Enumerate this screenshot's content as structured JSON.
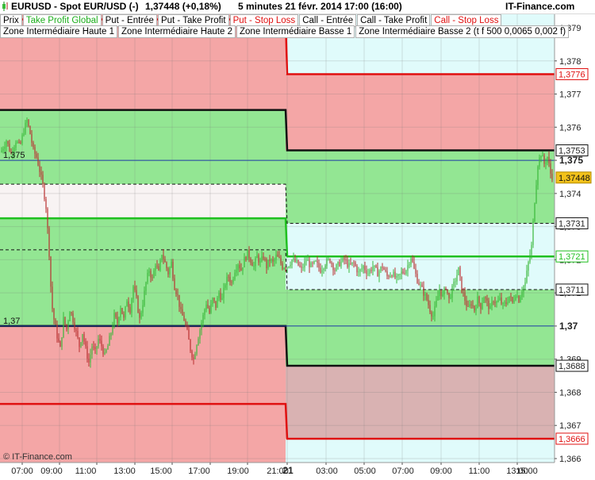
{
  "header": {
    "instrument": "EURUSD - Spot EUR/USD (-)",
    "quote": "1,37448 (+0,18%)",
    "period": "5 minutes  21 févr. 2014 17:00 (16:00)",
    "brand": "IT-Finance.com"
  },
  "legend_row1": [
    "Prix",
    "Take Profit Global",
    "Put - Entrée",
    "Put - Take Profit",
    "Put - Stop Loss",
    "Call - Entrée",
    "Call - Take Profit",
    "Call - Stop Loss"
  ],
  "legend_row2": [
    "Zone Intermédiaire Haute 1",
    "Zone Intermédiaire Haute 2",
    "Zone Intermédiaire Basse 1",
    "Zone Intermédiaire Basse 2 (t f 500 0,0065 0,002 f)"
  ],
  "watermark": "© IT-Finance.com",
  "colors": {
    "red_zone": "#f4a6a6",
    "green_zone": "#93e693",
    "cyan_zone": "#e0fbfb",
    "gray_zone": "#d9b2b2",
    "candle_up": "#38b838",
    "candle_down": "#b83030",
    "red_line": "#e01010",
    "green_line": "#20c020",
    "blue_line": "#1f3fa8",
    "current_price_bg": "#f2c21b"
  },
  "chart_data": {
    "type": "candlestick",
    "ylim": [
      1.3657,
      1.3793
    ],
    "y_ticks": [
      "1,379",
      "1,378",
      "1,377",
      "1,376",
      "1,375",
      "1,374",
      "1,373",
      "1,372",
      "1,371",
      "1,37",
      "1,369",
      "1,368",
      "1,367",
      "1,366"
    ],
    "x_ticks": [
      "07:00",
      "09:00",
      "11:00",
      "13:00",
      "15:00",
      "17:00",
      "19:00",
      "21:00",
      "21",
      "03:00",
      "05:00",
      "07:00",
      "09:00",
      "11:00",
      "13:00",
      "15:00"
    ],
    "left_labels": [
      "1,375",
      "1,37"
    ],
    "last_price": "1,37448",
    "levels_day1": {
      "put_stop_loss": 1.37675,
      "take_profit_global": 1.37652,
      "zone_haute_1": 1.37428,
      "call_entree": 1.37325,
      "zone_basse_1": 1.3723,
      "put_entree": 1.37,
      "call_stop_loss": 1.36765
    },
    "levels_day2": {
      "put_stop_loss": 1.3776,
      "call_take_profit": 1.3753,
      "zone_haute": 1.3731,
      "call_entree": 1.3721,
      "zone_basse": 1.3711,
      "put_take_profit": 1.3688,
      "call_stop_loss": 1.3666
    },
    "right_labels": [
      "1,3776",
      "1,3753",
      "1,375",
      "1,37448",
      "1,3731",
      "1,3721",
      "1,3711",
      "1,37",
      "1,3688",
      "1,3666"
    ],
    "price_path": [
      [
        0,
        1.3752
      ],
      [
        8,
        1.3756
      ],
      [
        14,
        1.3752
      ],
      [
        20,
        1.3756
      ],
      [
        25,
        1.3754
      ],
      [
        30,
        1.3759
      ],
      [
        34,
        1.3762
      ],
      [
        38,
        1.3758
      ],
      [
        42,
        1.3753
      ],
      [
        46,
        1.3751
      ],
      [
        50,
        1.3747
      ],
      [
        55,
        1.3741
      ],
      [
        58,
        1.3736
      ],
      [
        62,
        1.3722
      ],
      [
        65,
        1.3707
      ],
      [
        68,
        1.3702
      ],
      [
        72,
        1.3697
      ],
      [
        76,
        1.3693
      ],
      [
        80,
        1.3702
      ],
      [
        84,
        1.3699
      ],
      [
        88,
        1.3705
      ],
      [
        92,
        1.3702
      ],
      [
        96,
        1.3698
      ],
      [
        100,
        1.3694
      ],
      [
        104,
        1.3698
      ],
      [
        108,
        1.3693
      ],
      [
        112,
        1.3689
      ],
      [
        116,
        1.3694
      ],
      [
        120,
        1.3692
      ],
      [
        124,
        1.3696
      ],
      [
        128,
        1.3694
      ],
      [
        132,
        1.3691
      ],
      [
        136,
        1.3694
      ],
      [
        140,
        1.3698
      ],
      [
        144,
        1.3703
      ],
      [
        148,
        1.3701
      ],
      [
        152,
        1.3706
      ],
      [
        156,
        1.3702
      ],
      [
        160,
        1.3708
      ],
      [
        164,
        1.3705
      ],
      [
        168,
        1.3712
      ],
      [
        172,
        1.3708
      ],
      [
        176,
        1.3702
      ],
      [
        180,
        1.3707
      ],
      [
        184,
        1.3713
      ],
      [
        188,
        1.3717
      ],
      [
        192,
        1.3714
      ],
      [
        196,
        1.3719
      ],
      [
        200,
        1.3716
      ],
      [
        204,
        1.3722
      ],
      [
        208,
        1.3719
      ],
      [
        212,
        1.3716
      ],
      [
        216,
        1.3719
      ],
      [
        220,
        1.3712
      ],
      [
        224,
        1.3709
      ],
      [
        228,
        1.3704
      ],
      [
        232,
        1.3702
      ],
      [
        236,
        1.3698
      ],
      [
        240,
        1.3693
      ],
      [
        244,
        1.369
      ],
      [
        248,
        1.3695
      ],
      [
        252,
        1.3699
      ],
      [
        256,
        1.3703
      ],
      [
        260,
        1.3707
      ],
      [
        264,
        1.3704
      ],
      [
        268,
        1.3708
      ],
      [
        272,
        1.3706
      ],
      [
        276,
        1.371
      ],
      [
        280,
        1.3708
      ],
      [
        284,
        1.3713
      ],
      [
        288,
        1.3715
      ],
      [
        292,
        1.3713
      ],
      [
        296,
        1.3717
      ],
      [
        300,
        1.3719
      ],
      [
        304,
        1.3717
      ],
      [
        308,
        1.372
      ],
      [
        312,
        1.3722
      ],
      [
        316,
        1.372
      ],
      [
        320,
        1.3718
      ],
      [
        324,
        1.3721
      ],
      [
        328,
        1.3719
      ],
      [
        332,
        1.3721
      ],
      [
        336,
        1.3718
      ],
      [
        340,
        1.372
      ],
      [
        344,
        1.3719
      ],
      [
        348,
        1.3721
      ],
      [
        352,
        1.372
      ],
      [
        356,
        1.3718
      ],
      [
        362,
        1.3718
      ],
      [
        368,
        1.372
      ],
      [
        374,
        1.3719
      ],
      [
        380,
        1.3717
      ],
      [
        386,
        1.372
      ],
      [
        392,
        1.3718
      ],
      [
        398,
        1.3719
      ],
      [
        404,
        1.3717
      ],
      [
        410,
        1.3719
      ],
      [
        416,
        1.372
      ],
      [
        422,
        1.3717
      ],
      [
        428,
        1.3719
      ],
      [
        434,
        1.372
      ],
      [
        440,
        1.3718
      ],
      [
        446,
        1.3719
      ],
      [
        452,
        1.3716
      ],
      [
        458,
        1.3718
      ],
      [
        464,
        1.3716
      ],
      [
        470,
        1.3718
      ],
      [
        476,
        1.3716
      ],
      [
        482,
        1.3718
      ],
      [
        488,
        1.3715
      ],
      [
        494,
        1.3716
      ],
      [
        500,
        1.3714
      ],
      [
        506,
        1.3716
      ],
      [
        512,
        1.3717
      ],
      [
        518,
        1.3721
      ],
      [
        522,
        1.3717
      ],
      [
        526,
        1.3714
      ],
      [
        530,
        1.3712
      ],
      [
        534,
        1.371
      ],
      [
        538,
        1.3708
      ],
      [
        542,
        1.3705
      ],
      [
        546,
        1.3703
      ],
      [
        550,
        1.3707
      ],
      [
        554,
        1.3711
      ],
      [
        558,
        1.3709
      ],
      [
        562,
        1.3712
      ],
      [
        566,
        1.3708
      ],
      [
        570,
        1.3711
      ],
      [
        574,
        1.3714
      ],
      [
        578,
        1.3717
      ],
      [
        582,
        1.3711
      ],
      [
        586,
        1.3708
      ],
      [
        590,
        1.3705
      ],
      [
        594,
        1.3707
      ],
      [
        598,
        1.3705
      ],
      [
        602,
        1.3708
      ],
      [
        606,
        1.3706
      ],
      [
        610,
        1.3709
      ],
      [
        614,
        1.3707
      ],
      [
        618,
        1.3705
      ],
      [
        622,
        1.3708
      ],
      [
        626,
        1.3707
      ],
      [
        630,
        1.3708
      ],
      [
        634,
        1.3706
      ],
      [
        638,
        1.3707
      ],
      [
        642,
        1.3709
      ],
      [
        646,
        1.3707
      ],
      [
        650,
        1.371
      ],
      [
        654,
        1.3708
      ],
      [
        658,
        1.3711
      ],
      [
        662,
        1.3713
      ],
      [
        666,
        1.3719
      ],
      [
        670,
        1.3724
      ],
      [
        674,
        1.3738
      ],
      [
        678,
        1.3749
      ],
      [
        682,
        1.3752
      ],
      [
        686,
        1.3749
      ],
      [
        690,
        1.3751
      ],
      [
        694,
        1.3746
      ],
      [
        697,
        1.37448
      ]
    ]
  }
}
